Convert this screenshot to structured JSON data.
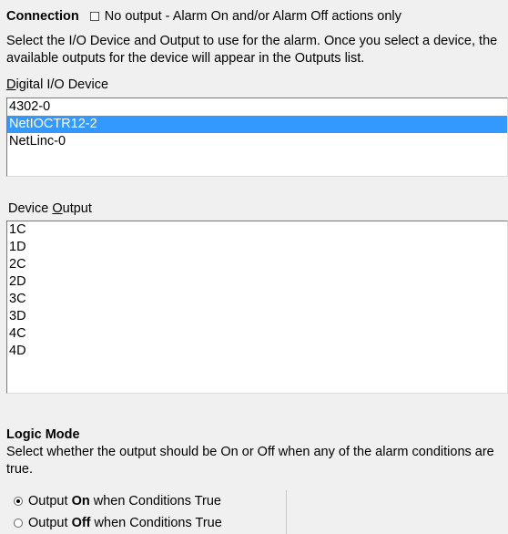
{
  "connection": {
    "heading": "Connection",
    "no_output_label": "No output - Alarm On and/or  Alarm Off actions only",
    "no_output_checked": false,
    "instructions": "Select the I/O Device and Output to use for the alarm.  Once you select a device, the available outputs for the device will appear in the Outputs list."
  },
  "device_list": {
    "label_prefix": "",
    "label_accel": "D",
    "label_rest": "igital I/O Device",
    "items": [
      "4302-0",
      "NetIOCTR12-2",
      "NetLinc-0"
    ],
    "selected": "NetIOCTR12-2"
  },
  "output_list": {
    "label_prefix": "Device ",
    "label_accel": "O",
    "label_rest": "utput",
    "items": [
      "1C",
      "1D",
      "2C",
      "2D",
      "3C",
      "3D",
      "4C",
      "4D"
    ]
  },
  "logic_mode": {
    "heading": "Logic Mode",
    "instructions": "Select whether the output should be On or Off when any of the alarm conditions are true.",
    "selected": "on",
    "options": [
      {
        "pre": "Output ",
        "key": "On",
        "post": " when Conditions True"
      },
      {
        "pre": "Output ",
        "key": "Off",
        "post": " when Conditions True"
      }
    ]
  },
  "colors": {
    "background": "#f0f0f0",
    "selection": "#3399ff"
  }
}
